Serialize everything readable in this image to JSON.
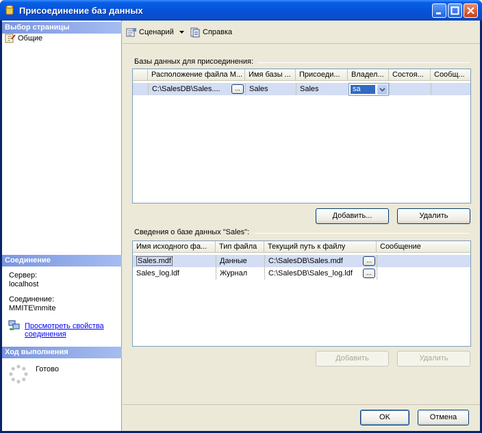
{
  "window": {
    "title": "Присоединение баз данных"
  },
  "left": {
    "select_page_header": "Выбор страницы",
    "page_general": "Общие",
    "connection_header": "Соединение",
    "server_label": "Сервер:",
    "server_value": "localhost",
    "connection_label": "Соединение:",
    "connection_value": "MMITE\\mmite",
    "view_props_link_line1": "Просмотреть свойства",
    "view_props_link_line2": "соединения",
    "progress_header": "Ход выполнения",
    "progress_status": "Готово"
  },
  "toolbar": {
    "script_label": "Сценарий",
    "help_label": "Справка"
  },
  "attach": {
    "group_label": "Базы данных для присоединения:",
    "columns": [
      "Расположение файла M...",
      "Имя базы ...",
      "Присоеди...",
      "Владел...",
      "Состоя...",
      "Сообщ..."
    ],
    "row": {
      "location": "C:\\SalesDB\\Sales....",
      "db_name": "Sales",
      "attach_as": "Sales",
      "owner": "sa",
      "status": "",
      "message": ""
    },
    "add_button": "Добавить...",
    "remove_button": "Удалить"
  },
  "details": {
    "group_label": "Сведения о базе данных \"Sales\":",
    "columns": [
      "Имя исходного фа...",
      "Тип файла",
      "Текущий путь к файлу",
      "Сообщение"
    ],
    "rows": [
      {
        "name": "Sales.mdf",
        "type": "Данные",
        "path": "C:\\SalesDB\\Sales.mdf",
        "message": ""
      },
      {
        "name": "Sales_log.ldf",
        "type": "Журнал",
        "path": "C:\\SalesDB\\Sales_log.ldf",
        "message": ""
      }
    ],
    "add_button": "Добавить",
    "remove_button": "Удалить"
  },
  "footer": {
    "ok_button": "OK",
    "cancel_button": "Отмена"
  },
  "colors": {
    "title_bar": "#0553d8",
    "frame": "#ece9d8",
    "selected_row": "#d3ddf3",
    "link": "#0000ff"
  },
  "icons": [
    "database-icon",
    "page-icon",
    "script-icon",
    "dropdown-arrow-icon",
    "help-icon",
    "connection-icon",
    "progress-spinner-icon",
    "minimize-icon",
    "maximize-icon",
    "close-icon"
  ]
}
